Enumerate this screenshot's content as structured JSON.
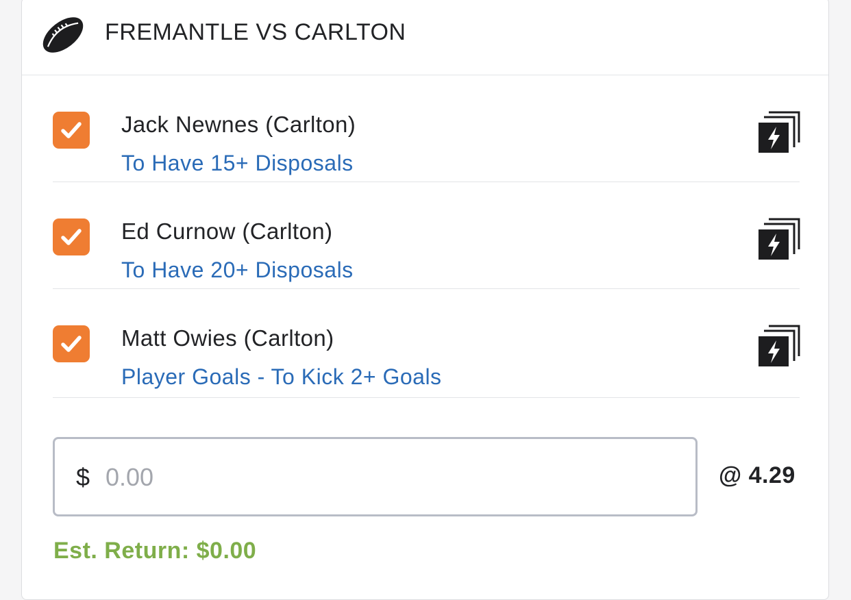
{
  "match": {
    "title": "FREMANTLE VS CARLTON",
    "sport_icon": "football-icon"
  },
  "legs": [
    {
      "player": "Jack Newnes (Carlton)",
      "market": "To Have 15+ Disposals",
      "checked": true
    },
    {
      "player": "Ed Curnow (Carlton)",
      "market": "To Have 20+ Disposals",
      "checked": true
    },
    {
      "player": "Matt Owies (Carlton)",
      "market": "Player Goals - To Kick 2+ Goals",
      "checked": true
    }
  ],
  "stake": {
    "currency": "$",
    "placeholder": "0.00"
  },
  "odds": "@ 4.29",
  "est_return": "Est. Return: $0.00",
  "colors": {
    "accent_orange": "#ef7d32",
    "link_blue": "#2a6bb7",
    "return_green": "#7fae4a"
  }
}
